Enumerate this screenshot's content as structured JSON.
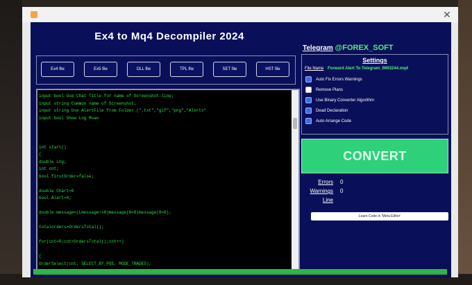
{
  "app": {
    "title": "Ex4 to Mq4 Decompiler 2024",
    "telegram_label": "Telegram",
    "telegram_handle": "@FOREX_SOFT"
  },
  "toolbar": {
    "buttons": [
      "Ex4 file",
      "Ex5 file",
      "DLL file",
      "TPL file",
      "SET file",
      "HST file"
    ]
  },
  "code": {
    "lines": [
      "input bool    Use Chat Title for name of Screenshot-line;",
      "input string  Common name of Screenshot;",
      "input string  Use AlertFile from Folder (\".txt\",\"gif\",\"png\",\"Alerts\"",
      "input bool    Show Log Msan",
      "",
      "",
      "",
      "int start()",
      "{",
      "  double Lng;",
      "  int cnt;",
      "  bool firstOrder=false;",
      "",
      "  double Chart=0",
      "  bool Alert=0;",
      "",
      "  double message=(Lmessage!=0)message(0=0)message(0=0);",
      "",
      "  totalorders=OrdersTotal();",
      "",
      "  for(cnt=0;cnt<OrdersTotal();cnt++)",
      "",
      "  {",
      "    OrderSelect(cnt, SELECT_BY_POS, MODE_TRADES);"
    ]
  },
  "settings": {
    "title": "Settings",
    "file_name_label": "File Name",
    "file_name_value": "Forward Alert To Telegram_IM93244.mq4",
    "options": [
      {
        "label": "Auto Fix Errors Warnings",
        "checked": true
      },
      {
        "label": "Remove Plans",
        "checked": false
      },
      {
        "label": "Use Binary Converter Algorithm",
        "checked": true
      },
      {
        "label": "Dead Declaration",
        "checked": true
      },
      {
        "label": "Auto Arrange Code",
        "checked": true
      }
    ]
  },
  "convert": {
    "label": "CONVERT"
  },
  "stats": {
    "errors_label": "Errors",
    "errors_value": "0",
    "warnings_label": "Warnings",
    "warnings_value": "0",
    "line_label": "Line",
    "line_value": ""
  },
  "learn": {
    "label": "Learn Code in 'Meta Editor'"
  },
  "progress": {
    "fraction": 1.0
  },
  "colors": {
    "panel_bg": "#0a0f59",
    "code_text": "#29e34b",
    "convert_bg": "#2ed07a",
    "progress": "#2eb64a"
  },
  "icons": {
    "window": "app-icon",
    "close": "close-icon"
  }
}
